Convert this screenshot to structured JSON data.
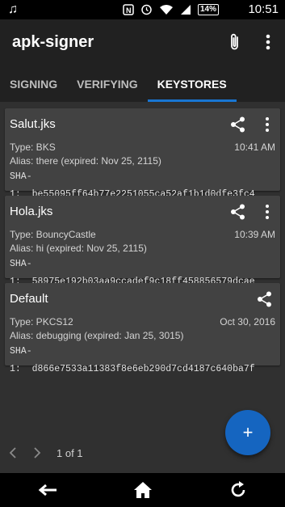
{
  "status_bar": {
    "battery": "14%",
    "time": "10:51",
    "icons": [
      "music-note-icon",
      "nfc-icon",
      "alarm-icon",
      "wifi-icon",
      "signal-icon",
      "battery-icon"
    ]
  },
  "app_bar": {
    "title": "apk-signer",
    "actions": [
      "attach-icon",
      "more-vert-icon"
    ]
  },
  "tabs": [
    {
      "label": "SIGNING",
      "active": false
    },
    {
      "label": "VERIFYING",
      "active": false
    },
    {
      "label": "KEYSTORES",
      "active": true
    }
  ],
  "keystores": [
    {
      "name": "Salut.jks",
      "type": "Type: BKS",
      "time": "10:41 AM",
      "alias": "Alias: there (expired: Nov 25, 2115)",
      "sha_label": "SHA-1:",
      "sha": "be55095ff64b77e2251055ca52af1b1d0dfe3fc4",
      "has_menu": true
    },
    {
      "name": "Hola.jks",
      "type": "Type: BouncyCastle",
      "time": "10:39 AM",
      "alias": "Alias: hi (expired: Nov 25, 2115)",
      "sha_label": "SHA-1:",
      "sha": "58975e192b03aa9ccadef9c18ff458856579dcae",
      "has_menu": true
    },
    {
      "name": "Default",
      "type": "Type: PKCS12",
      "time": "Oct 30, 2016",
      "alias": "Alias: debugging (expired: Jan 25, 3015)",
      "sha_label": "SHA-1:",
      "sha": "d866e7533a11383f8e6eb290d7cd4187c640ba7f",
      "has_menu": false
    }
  ],
  "fab": {
    "label": "+"
  },
  "pager": {
    "text": "1 of 1"
  },
  "nav_bar": [
    "back-icon",
    "home-icon",
    "recent-apps-icon"
  ],
  "colors": {
    "accent": "#1976d2",
    "fab": "#1565c0",
    "card": "#424242",
    "appbar": "#212121"
  }
}
